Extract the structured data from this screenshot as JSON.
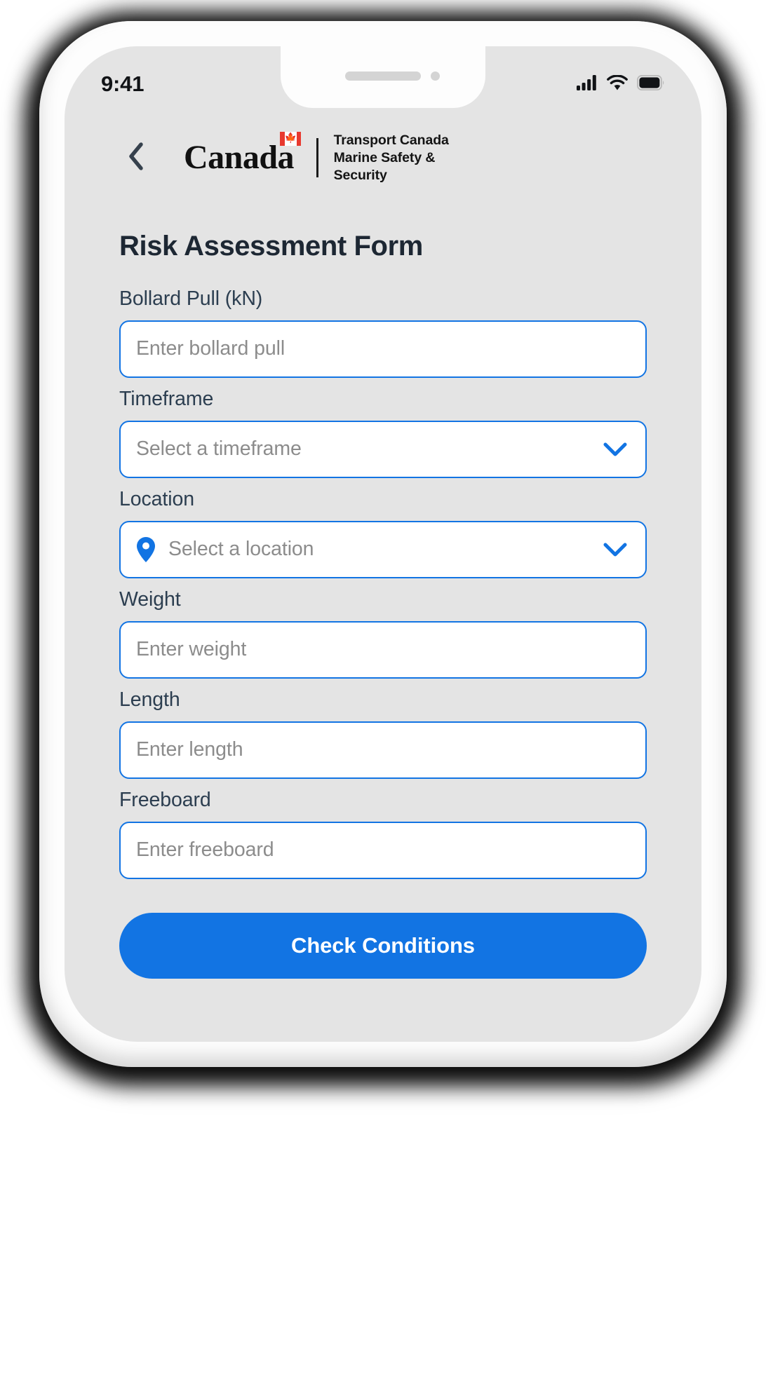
{
  "status_bar": {
    "time": "9:41",
    "signal_icon": "cellular-signal-icon",
    "wifi_icon": "wifi-icon",
    "battery_icon": "battery-full-icon"
  },
  "header": {
    "back_icon": "chevron-left-icon",
    "wordmark": "Canada",
    "flag_icon": "canada-flag-icon",
    "department_line1": "Transport Canada",
    "department_line2": "Marine Safety &",
    "department_line3": "Security"
  },
  "page": {
    "title": "Risk Assessment Form"
  },
  "form": {
    "fields": [
      {
        "label": "Bollard Pull (kN)",
        "placeholder": "Enter bollard pull",
        "type": "text",
        "name": "bollard-pull"
      },
      {
        "label": "Timeframe",
        "placeholder": "Select a timeframe",
        "type": "select",
        "name": "timeframe"
      },
      {
        "label": "Location",
        "placeholder": "Select a location",
        "type": "select-location",
        "name": "location"
      },
      {
        "label": "Weight",
        "placeholder": "Enter weight",
        "type": "text",
        "name": "weight"
      },
      {
        "label": "Length",
        "placeholder": "Enter length",
        "type": "text",
        "name": "length"
      },
      {
        "label": "Freeboard",
        "placeholder": "Enter freeboard",
        "type": "text",
        "name": "freeboard"
      }
    ],
    "submit_label": "Check Conditions"
  },
  "colors": {
    "accent": "#1274e3",
    "screen_bg": "#e4e4e4",
    "label_text": "#2c3e50",
    "title_text": "#1d2733",
    "placeholder_text": "#8c8c8c",
    "flag_red": "#e8392f"
  }
}
